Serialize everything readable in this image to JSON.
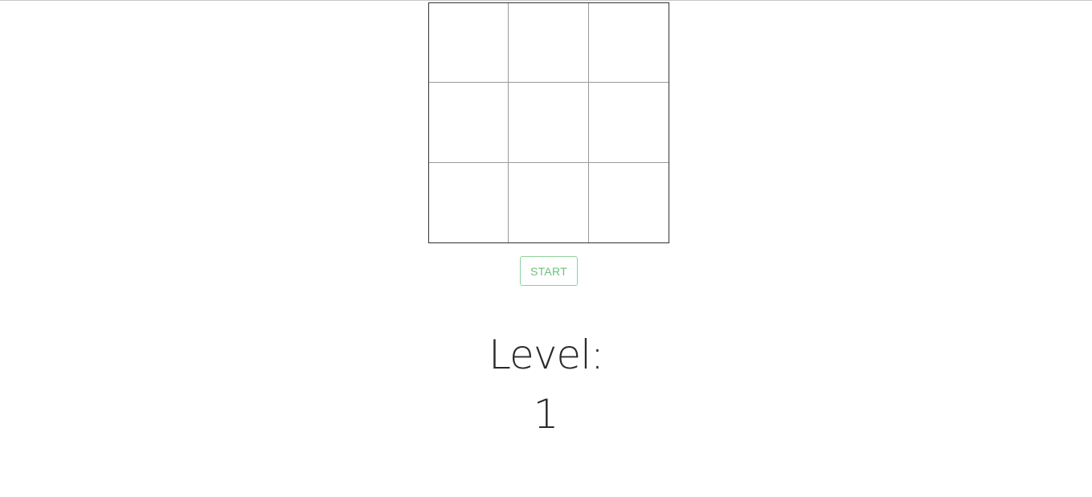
{
  "board": {
    "cells": [
      "",
      "",
      "",
      "",
      "",
      "",
      "",
      "",
      ""
    ]
  },
  "controls": {
    "start_label": "START"
  },
  "level": {
    "label": "Level:",
    "value": "1"
  },
  "colors": {
    "accent": "#6cbf7a",
    "accent_border": "#8fd19b",
    "text": "#2a2a2a"
  }
}
